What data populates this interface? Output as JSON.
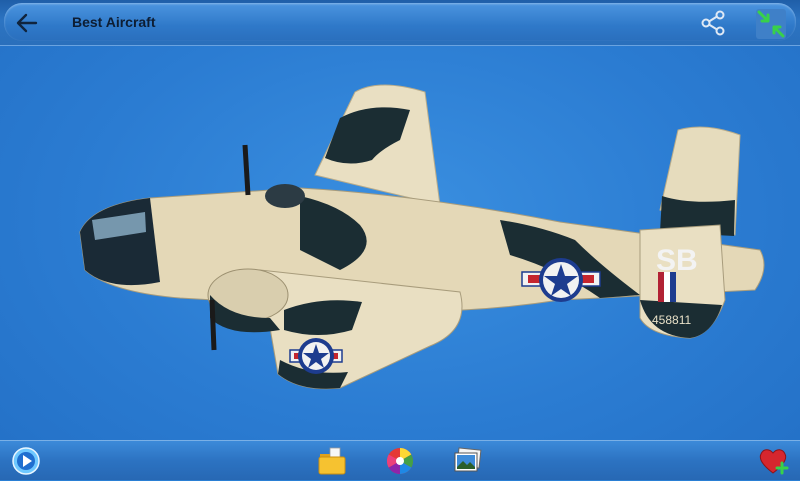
{
  "app": {
    "title": "Best Aircraft"
  },
  "photo": {
    "subject": "aircraft-photo",
    "fuselage_code": "SB",
    "tail_number": "458811"
  },
  "icons": {
    "back": "back-arrow-icon",
    "share": "share-icon",
    "fullscreen": "fullscreen-toggle-icon",
    "play": "slideshow-play-icon",
    "folder": "folder-icon",
    "color": "color-wheel-icon",
    "gallery": "gallery-icon",
    "favorite": "add-favorite-icon"
  },
  "colors": {
    "sky": "#2b7cd2",
    "bar": "#2c74c2",
    "title_text": "#0d1d33"
  }
}
